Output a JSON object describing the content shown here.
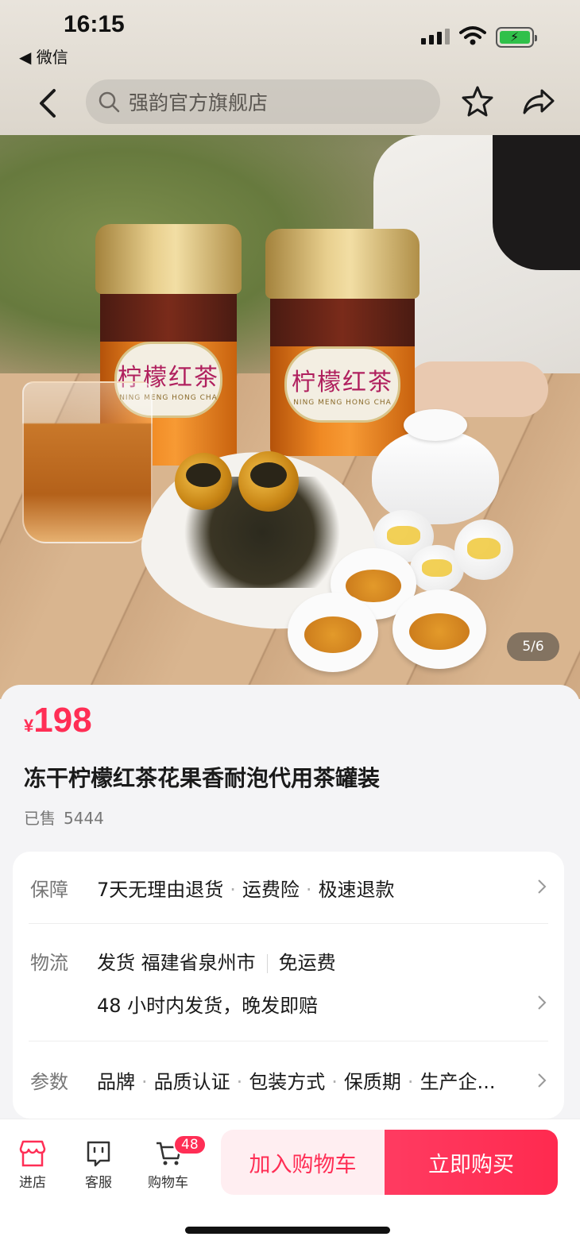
{
  "status": {
    "time": "16:15",
    "back_app": "◀ 微信"
  },
  "header": {
    "search_placeholder": "强韵官方旗舰店"
  },
  "gallery": {
    "counter": "5/6"
  },
  "product": {
    "price_symbol": "¥",
    "price": "198",
    "title": "冻干柠檬红茶花果香耐泡代用茶罐装",
    "sold_label": "已售",
    "sold_count": "5444",
    "can_label_cn": "柠檬红茶",
    "can_label_py": "NING MENG HONG CHA"
  },
  "service": {
    "guarantee": {
      "label": "保障",
      "items": [
        "7天无理由退货",
        "运费险",
        "极速退款"
      ]
    },
    "logistics": {
      "label": "物流",
      "ship_from": "发货 福建省泉州市",
      "shipping_fee": "免运费",
      "note": "48 小时内发货，晚发即赔"
    },
    "params": {
      "label": "参数",
      "items": [
        "品牌",
        "品质认证",
        "包装方式",
        "保质期",
        "生产企..."
      ]
    }
  },
  "bottom": {
    "store": "进店",
    "service": "客服",
    "cart": "购物车",
    "cart_badge": "48",
    "add_to_cart": "加入购物车",
    "buy_now": "立即购买"
  },
  "colors": {
    "accent": "#ff2e55",
    "battery": "#30c04a"
  }
}
